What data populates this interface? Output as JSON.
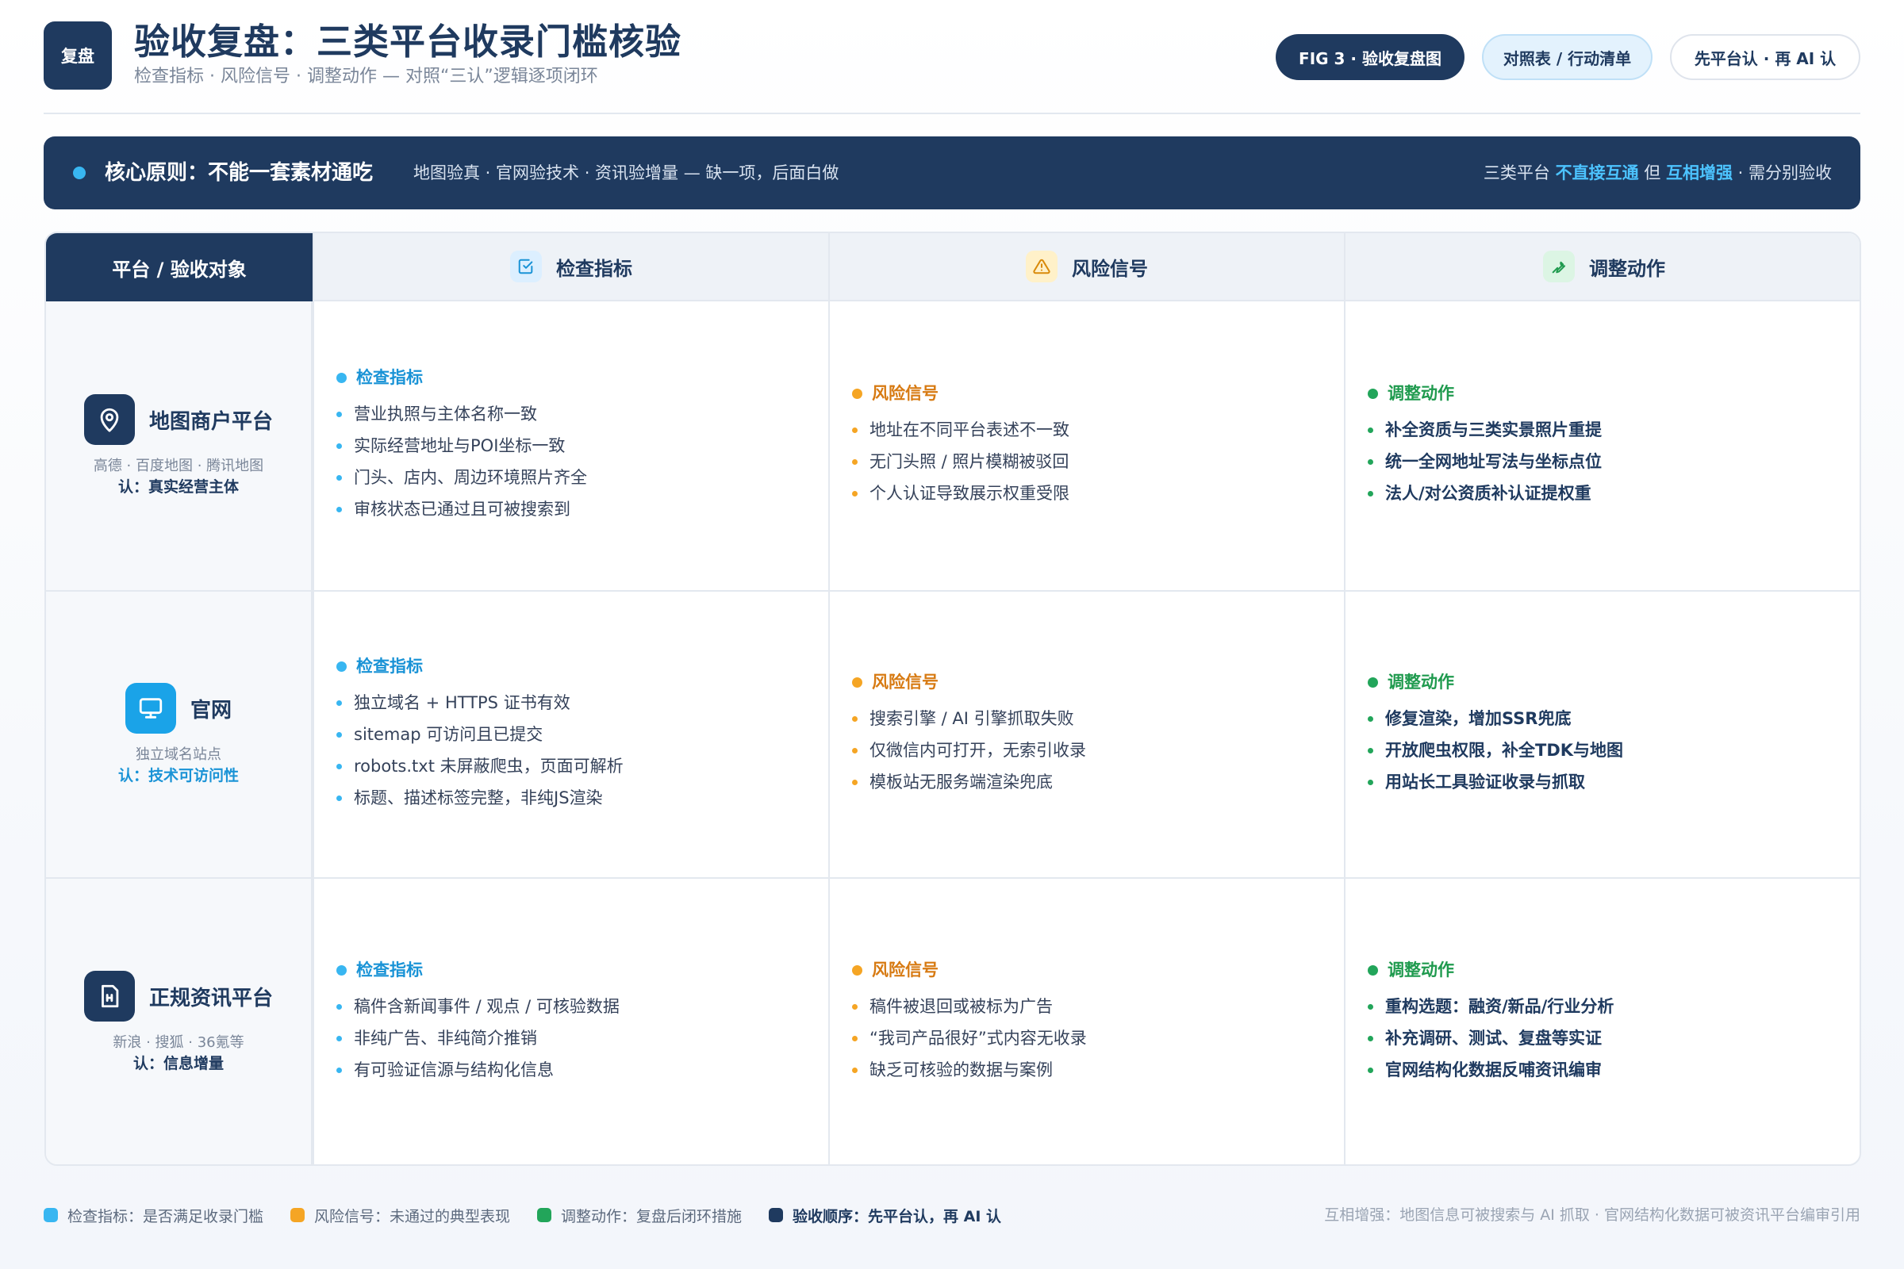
{
  "header": {
    "logo": "复盘",
    "title": "验收复盘：三类平台收录门槛核验",
    "subtitle": "检查指标 · 风险信号 · 调整动作 — 对照“三认”逻辑逐项闭环",
    "pill_fig": "FIG 3 · 验收复盘图",
    "pill_table": "对照表 / 行动清单",
    "pill_order": "先平台认 · 再 AI 认"
  },
  "banner": {
    "title": "核心原则：不能一套素材通吃",
    "desc": "地图验真 · 官网验技术 · 资讯验增量 — 缺一项，后面白做",
    "right_1": "三类平台 ",
    "right_2": "不直接互通",
    "right_3": " 但 ",
    "right_4": "互相增强",
    "right_5": " · 需分别验收"
  },
  "matrix": {
    "corner": "平台 / 验收对象",
    "columns": [
      "检查指标",
      "风险信号",
      "调整动作"
    ],
    "rows": [
      {
        "name": "地图商户平台",
        "examples": "高德 · 百度地图 · 腾讯地图",
        "recognize": "认：真实经营主体",
        "check_heading": "检查指标",
        "check": [
          "营业执照与主体名称一致",
          "实际经营地址与POI坐标一致",
          "门头、店内、周边环境照片齐全",
          "审核状态已通过且可被搜索到"
        ],
        "risk_heading": "风险信号",
        "risk": [
          "地址在不同平台表述不一致",
          "无门头照 / 照片模糊被驳回",
          "个人认证导致展示权重受限"
        ],
        "action_heading": "调整动作",
        "action": [
          "补全资质与三类实景照片重提",
          "统一全网地址写法与坐标点位",
          "法人/对公资质补认证提权重"
        ]
      },
      {
        "name": "官网",
        "examples": "独立域名站点",
        "recognize": "认：技术可访问性",
        "check_heading": "检查指标",
        "check": [
          "独立域名 + HTTPS 证书有效",
          "sitemap 可访问且已提交",
          "robots.txt 未屏蔽爬虫，页面可解析",
          "标题、描述标签完整，非纯JS渲染"
        ],
        "risk_heading": "风险信号",
        "risk": [
          "搜索引擎 / AI 引擎抓取失败",
          "仅微信内可打开，无索引收录",
          "模板站无服务端渲染兜底"
        ],
        "action_heading": "调整动作",
        "action": [
          "修复渲染，增加SSR兜底",
          "开放爬虫权限，补全TDK与地图",
          "用站长工具验证收录与抓取"
        ]
      },
      {
        "name": "正规资讯平台",
        "examples": "新浪 · 搜狐 · 36氪等",
        "recognize": "认：信息增量",
        "check_heading": "检查指标",
        "check": [
          "稿件含新闻事件 / 观点 / 可核验数据",
          "非纯广告、非纯简介推销",
          "有可验证信源与结构化信息"
        ],
        "risk_heading": "风险信号",
        "risk": [
          "稿件被退回或被标为广告",
          "“我司产品很好”式内容无收录",
          "缺乏可核验的数据与案例"
        ],
        "action_heading": "调整动作",
        "action": [
          "重构选题：融资/新品/行业分析",
          "补充调研、测试、复盘等实证",
          "官网结构化数据反哺资讯编审"
        ]
      }
    ]
  },
  "legend": {
    "check": "检查指标：是否满足收录门槛",
    "risk": "风险信号：未通过的典型表现",
    "action": "调整动作：复盘后闭环措施",
    "order": "验收顺序：先平台认，再 AI 认",
    "note": "互相增强：地图信息可被搜索与 AI 抓取 · 官网结构化数据可被资讯平台编审引用"
  },
  "colors": {
    "navy": "#1f3a5f",
    "check": "#38b6f1",
    "risk": "#f5a524",
    "action": "#22a55a"
  },
  "icons": {
    "check_column": "checkbox-icon",
    "risk_column": "warning-triangle-icon",
    "action_column": "wrench-icon",
    "map_platform": "map-pin-icon",
    "website": "monitor-icon",
    "news_platform": "document-icon"
  }
}
